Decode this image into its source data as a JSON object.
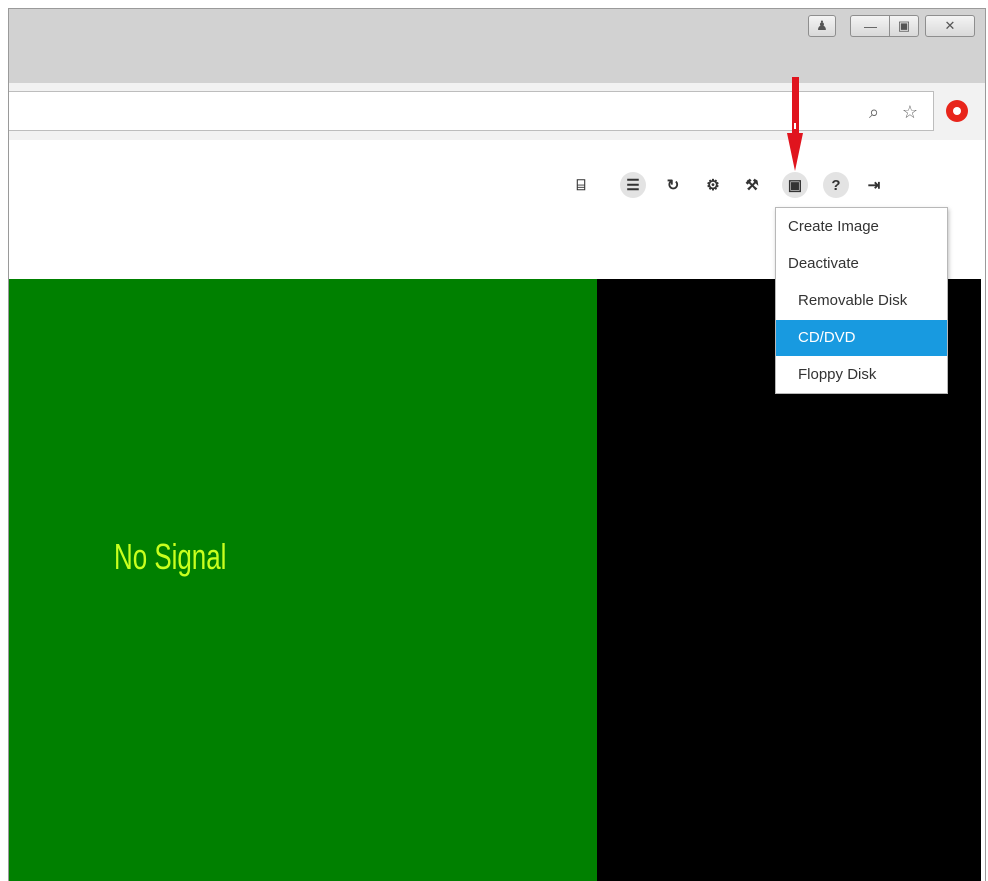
{
  "window": {
    "buttons": [
      {
        "name": "user",
        "glyph": "♟"
      },
      {
        "name": "minimize",
        "glyph": "—"
      },
      {
        "name": "maximize",
        "glyph": "▣"
      },
      {
        "name": "close",
        "glyph": "✕"
      }
    ]
  },
  "address_bar": {
    "url": "",
    "icons": [
      "zoom-icon",
      "bookmark-star-icon",
      "extension-icon"
    ],
    "zoom_glyph": "⌕",
    "star_glyph": "☆"
  },
  "toolbar": {
    "buttons": [
      {
        "name": "server-icon",
        "glyph": "⌸"
      },
      {
        "name": "list-icon",
        "glyph": "☰"
      },
      {
        "name": "refresh-icon",
        "glyph": "↻"
      },
      {
        "name": "power-settings-icon",
        "glyph": "⚙"
      },
      {
        "name": "tools-icon",
        "glyph": "⚒"
      },
      {
        "name": "virtual-media-icon",
        "glyph": "▣"
      },
      {
        "name": "help-icon",
        "glyph": "?"
      },
      {
        "name": "logout-icon",
        "glyph": "⇥"
      }
    ]
  },
  "virtual_media_menu": {
    "items": [
      {
        "label": "Create Image",
        "level": "top",
        "active": false
      },
      {
        "label": "Deactivate",
        "level": "top",
        "active": false
      },
      {
        "label": "Removable Disk",
        "level": "sub",
        "active": false
      },
      {
        "label": "CD/DVD",
        "level": "sub",
        "active": true
      },
      {
        "label": "Floppy Disk",
        "level": "sub",
        "active": false
      }
    ]
  },
  "console": {
    "status_text": "No Signal",
    "colors": {
      "left_panel": "#008000",
      "right_panel": "#000000",
      "text": "#c8ff1e"
    }
  },
  "annotation": {
    "arrow_color": "#e0141e"
  },
  "colors": {
    "menu_highlight": "#189ae0",
    "titlebar": "#d2d2d2"
  }
}
